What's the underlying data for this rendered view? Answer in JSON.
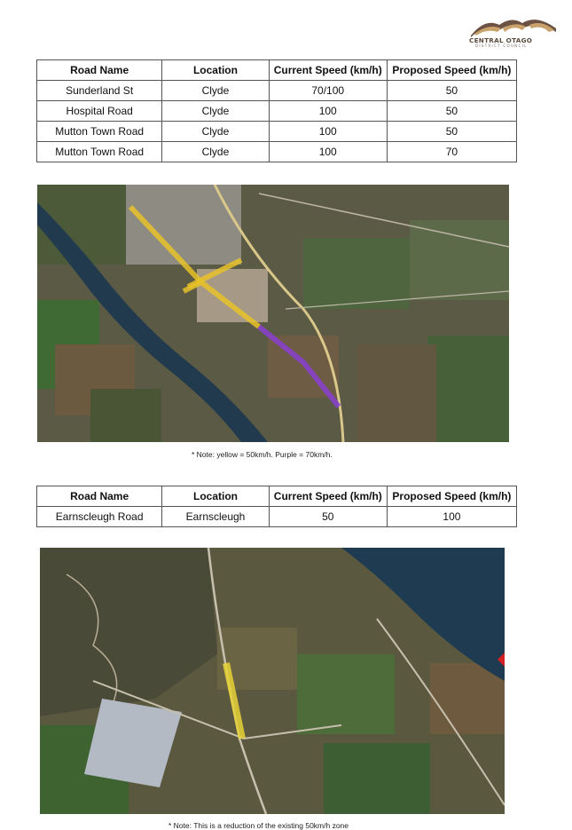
{
  "logo": {
    "name": "CENTRAL OTAGO",
    "subtitle": "DISTRICT COUNCIL",
    "colors": {
      "brown": "#6b5243",
      "tan": "#c9a26b"
    }
  },
  "table1": {
    "headers": [
      "Road Name",
      "Location",
      "Current Speed (km/h)",
      "Proposed Speed (km/h)"
    ],
    "rows": [
      [
        "Sunderland St",
        "Clyde",
        "70/100",
        "50"
      ],
      [
        "Hospital Road",
        "Clyde",
        "100",
        "50"
      ],
      [
        "Mutton Town Road",
        "Clyde",
        "100",
        "50"
      ],
      [
        "Mutton Town Road",
        "Clyde",
        "100",
        "70"
      ]
    ]
  },
  "map1": {
    "highlight_colors": {
      "yellow": "#e8c229",
      "purple": "#8a3fd0"
    }
  },
  "note1": "* Note: yellow = 50km/h. Purple = 70km/h.",
  "table2": {
    "headers": [
      "Road Name",
      "Location",
      "Current Speed (km/h)",
      "Proposed Speed (km/h)"
    ],
    "rows": [
      [
        "Earnscleugh Road",
        "Earnscleugh",
        "50",
        "100"
      ]
    ]
  },
  "map2": {
    "highlight_colors": {
      "yellow": "#e8d237"
    }
  },
  "note2": "* Note: This is a reduction of the existing 50km/h zone"
}
